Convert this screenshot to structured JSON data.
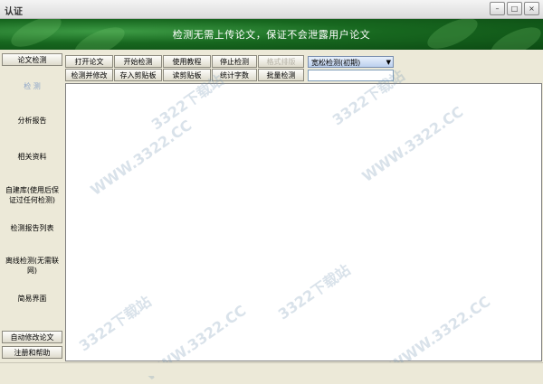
{
  "window": {
    "title": "认证"
  },
  "banner": {
    "message": "检测无需上传论文，保证不会泄露用户论文"
  },
  "sidebar": {
    "top_button": "论文检测",
    "items": [
      {
        "label": "检 测"
      },
      {
        "label": "分析报告"
      },
      {
        "label": "相关资料"
      },
      {
        "label": "自建库(使用后保证过任何检测)"
      },
      {
        "label": "检测报告列表"
      },
      {
        "label": "离线检测(无需联网)"
      },
      {
        "label": "简易界面"
      }
    ],
    "bottom_buttons": [
      {
        "label": "自动修改论文"
      },
      {
        "label": "注册和帮助"
      }
    ]
  },
  "toolbar": {
    "row1": [
      {
        "label": "打开论文"
      },
      {
        "label": "开始检测"
      },
      {
        "label": "使用教程"
      },
      {
        "label": "停止检测"
      },
      {
        "label": "格式排版"
      }
    ],
    "row2": [
      {
        "label": "检测并修改"
      },
      {
        "label": "存入剪贴板"
      },
      {
        "label": "读剪贴板"
      },
      {
        "label": "统计字数"
      },
      {
        "label": "批量检测"
      }
    ],
    "mode_select": {
      "value": "宽松检测(初期)"
    },
    "input": {
      "value": ""
    }
  },
  "watermark": {
    "text": "3322下载站",
    "url": "WWW.3322.CC"
  },
  "colors": {
    "banner": "#17671f",
    "active_nav": "#8aa3c8",
    "select_bg": "#bcd0ee"
  }
}
